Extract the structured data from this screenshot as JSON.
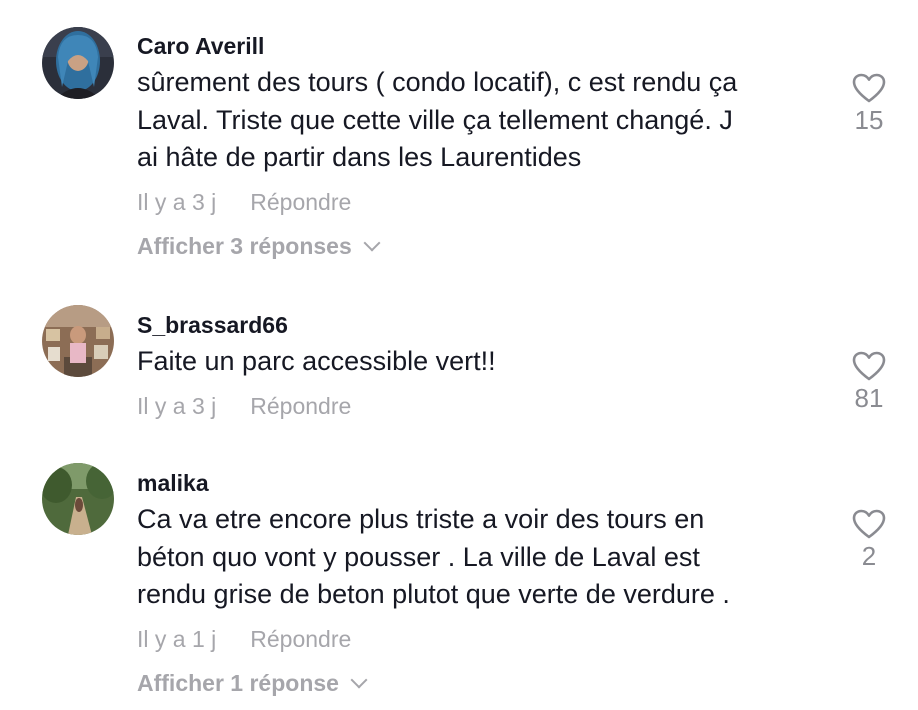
{
  "comments": [
    {
      "username": "Caro Averill",
      "text": "sûrement des tours ( condo locatif), c est rendu ça\nLaval. Triste que cette ville ça tellement changé. J\nai hâte de partir dans les Laurentides",
      "time": "Il y a 3 j",
      "reply_label": "Répondre",
      "likes": "15",
      "view_replies": "Afficher 3 réponses",
      "avatar_icon": "avatar-photo"
    },
    {
      "username": "S_brassard66",
      "text": "Faite un parc accessible vert!!",
      "time": "Il y a 3 j",
      "reply_label": "Répondre",
      "likes": "81",
      "avatar_icon": "avatar-photo"
    },
    {
      "username": "malika",
      "text": "Ca va etre encore plus triste a voir des tours en\nbéton quo vont y pousser . La ville de Laval est\nrendu grise de beton plutot que verte de verdure .",
      "time": "Il y a 1 j",
      "reply_label": "Répondre",
      "likes": "2",
      "view_replies": "Afficher 1 réponse",
      "avatar_icon": "avatar-photo"
    }
  ],
  "icons": {
    "like": "heart-outline-icon",
    "expand": "chevron-down-icon"
  }
}
